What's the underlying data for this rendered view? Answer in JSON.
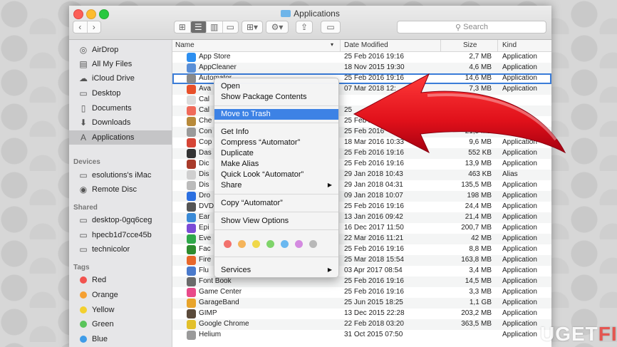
{
  "window": {
    "title": "Applications"
  },
  "toolbar": {
    "search_placeholder": "Search"
  },
  "sidebar": {
    "favorites": [
      {
        "label": "AirDrop",
        "icon": "airdrop-icon"
      },
      {
        "label": "All My Files",
        "icon": "all-files-icon"
      },
      {
        "label": "iCloud Drive",
        "icon": "cloud-icon"
      },
      {
        "label": "Desktop",
        "icon": "desktop-icon"
      },
      {
        "label": "Documents",
        "icon": "documents-icon"
      },
      {
        "label": "Downloads",
        "icon": "downloads-icon"
      },
      {
        "label": "Applications",
        "icon": "applications-icon"
      }
    ],
    "devices_header": "Devices",
    "devices": [
      {
        "label": "esolutions's iMac",
        "icon": "imac-icon"
      },
      {
        "label": "Remote Disc",
        "icon": "disc-icon"
      }
    ],
    "shared_header": "Shared",
    "shared": [
      {
        "label": "desktop-0gq6ceg",
        "icon": "computer-icon"
      },
      {
        "label": "hpecb1d7cce45b",
        "icon": "computer-icon"
      },
      {
        "label": "technicolor",
        "icon": "computer-icon"
      }
    ],
    "tags_header": "Tags",
    "tags": [
      {
        "label": "Red",
        "color": "#f2534f"
      },
      {
        "label": "Orange",
        "color": "#f5a032"
      },
      {
        "label": "Yellow",
        "color": "#f3d02f"
      },
      {
        "label": "Green",
        "color": "#59c45a"
      },
      {
        "label": "Blue",
        "color": "#3f9ce8"
      }
    ]
  },
  "columns": {
    "name": "Name",
    "date": "Date Modified",
    "size": "Size",
    "kind": "Kind"
  },
  "files": [
    {
      "name": "App Store",
      "date": "25 Feb 2016 19:16",
      "size": "2,7 MB",
      "kind": "Application",
      "color": "#2d8ff0"
    },
    {
      "name": "AppCleaner",
      "date": "18 Nov 2015 19:30",
      "size": "4,6 MB",
      "kind": "Application",
      "color": "#5a8fd6"
    },
    {
      "name": "Automator",
      "date": "25 Feb 2016 19:16",
      "size": "14,6 MB",
      "kind": "Application",
      "color": "#8a8a8a"
    },
    {
      "name": "Ava",
      "date": "07 Mar 2018 12:",
      "size": "7,3 MB",
      "kind": "Application",
      "color": "#e8502a"
    },
    {
      "name": "Cal",
      "date": "",
      "size": "",
      "kind": "",
      "color": "#dcdcdc"
    },
    {
      "name": "Cal",
      "date": "25",
      "size": "",
      "kind": "",
      "color": "#f06a5a"
    },
    {
      "name": "Che",
      "date": "25 Feb 2016",
      "size": "",
      "kind": "",
      "color": "#b88a3a"
    },
    {
      "name": "Con",
      "date": "25 Feb 2016",
      "size": "21,5 MB",
      "kind": "Application",
      "color": "#9a9a9a"
    },
    {
      "name": "Cop",
      "date": "18 Mar 2016 10:33",
      "size": "9,6 MB",
      "kind": "Application",
      "color": "#d64536"
    },
    {
      "name": "Das",
      "date": "25 Feb 2016 19:16",
      "size": "552 KB",
      "kind": "Application",
      "color": "#333333"
    },
    {
      "name": "Dic",
      "date": "25 Feb 2016 19:16",
      "size": "13,9 MB",
      "kind": "Application",
      "color": "#a83a2a"
    },
    {
      "name": "Dis",
      "date": "29 Jan 2018 10:43",
      "size": "463 KB",
      "kind": "Alias",
      "color": "#cfcfcf"
    },
    {
      "name": "Dis",
      "date": "29 Jan 2018 04:31",
      "size": "135,5 MB",
      "kind": "Application",
      "color": "#bbbbbb"
    },
    {
      "name": "Dro",
      "date": "09 Jan 2018 10:07",
      "size": "198 MB",
      "kind": "Application",
      "color": "#2b6fe0"
    },
    {
      "name": "DVD",
      "date": "25 Feb 2016 19:16",
      "size": "24,4 MB",
      "kind": "Application",
      "color": "#555555"
    },
    {
      "name": "Ear",
      "date": "13 Jan 2016 09:42",
      "size": "21,4 MB",
      "kind": "Application",
      "color": "#3a8ad6"
    },
    {
      "name": "Epi",
      "date": "16 Dec 2017 11:50",
      "size": "200,7 MB",
      "kind": "Application",
      "color": "#7b4bd6"
    },
    {
      "name": "Eve",
      "date": "22 Mar 2016 11:21",
      "size": "42 MB",
      "kind": "Application",
      "color": "#2fa84a"
    },
    {
      "name": "Fac",
      "date": "25 Feb 2016 19:16",
      "size": "8,8 MB",
      "kind": "Application",
      "color": "#2e8b2e"
    },
    {
      "name": "Fire",
      "date": "25 Mar 2018 15:54",
      "size": "163,8 MB",
      "kind": "Application",
      "color": "#e8672a"
    },
    {
      "name": "Flu",
      "date": "03 Apr 2017 08:54",
      "size": "3,4 MB",
      "kind": "Application",
      "color": "#4a7acc"
    },
    {
      "name": "Font Book",
      "date": "25 Feb 2016 19:16",
      "size": "14,5 MB",
      "kind": "Application",
      "color": "#6a6a6a"
    },
    {
      "name": "Game Center",
      "date": "25 Feb 2016 19:16",
      "size": "3,3 MB",
      "kind": "Application",
      "color": "#e84a8a"
    },
    {
      "name": "GarageBand",
      "date": "25 Jun 2015 18:25",
      "size": "1,1 GB",
      "kind": "Application",
      "color": "#e8a42a"
    },
    {
      "name": "GIMP",
      "date": "13 Dec 2015 22:28",
      "size": "203,2 MB",
      "kind": "Application",
      "color": "#5a4a3a"
    },
    {
      "name": "Google Chrome",
      "date": "22 Feb 2018 03:20",
      "size": "363,5 MB",
      "kind": "Application",
      "color": "#e2c02a"
    },
    {
      "name": "Helium",
      "date": "31 Oct 2015 07:50",
      "size": "",
      "kind": "Application",
      "color": "#9a9a9a"
    }
  ],
  "context_menu": {
    "open": "Open",
    "show_package": "Show Package Contents",
    "move_to_trash": "Move to Trash",
    "get_info": "Get Info",
    "compress": "Compress “Automator”",
    "duplicate": "Duplicate",
    "make_alias": "Make Alias",
    "quick_look": "Quick Look “Automator”",
    "share": "Share",
    "copy": "Copy “Automator”",
    "show_view_options": "Show View Options",
    "services": "Services",
    "tag_colors": [
      "#f2726d",
      "#f5b45a",
      "#f0d84a",
      "#7fd46a",
      "#6ab8f0",
      "#d48ae0",
      "#b8b8b8"
    ]
  },
  "watermark": {
    "left": "UG",
    "mid": "ET",
    "right": "FIX"
  }
}
